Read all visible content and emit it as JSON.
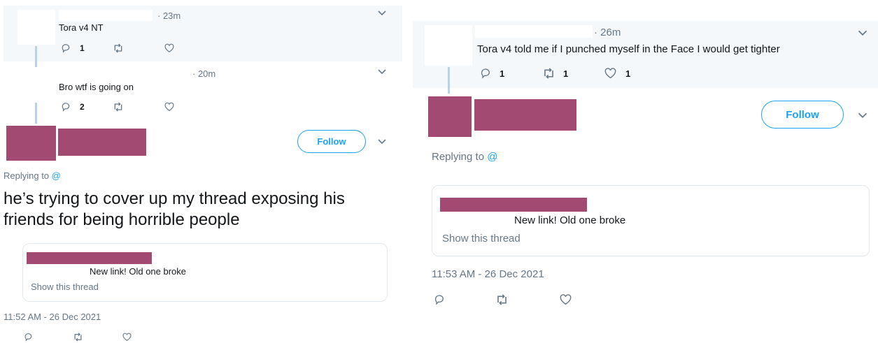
{
  "left": {
    "tweet1": {
      "time": "· 23m",
      "text": "Tora v4 NT",
      "replies": "1",
      "retweets": "",
      "likes": ""
    },
    "tweet2": {
      "time": "· 20m",
      "text": "Bro wtf is going on",
      "replies": "2",
      "retweets": "",
      "likes": ""
    },
    "main": {
      "follow_label": "Follow",
      "replying_label": "Replying to",
      "replying_handle": "@",
      "text": "he’s trying to cover up my thread exposing his friends for being horrible people",
      "quote_text": "New link! Old one broke",
      "show_thread": "Show this thread",
      "timestamp": "11:52 AM - 26 Dec 2021"
    }
  },
  "right": {
    "tweet1": {
      "time": "· 26m",
      "text": "Tora v4 told me if I punched myself in the Face I would get tighter",
      "replies": "1",
      "retweets": "1",
      "likes": "1"
    },
    "main": {
      "follow_label": "Follow",
      "replying_label": "Replying to",
      "replying_handle": "@",
      "quote_text": "New link! Old one broke",
      "show_thread": "Show this thread",
      "timestamp": "11:53 AM - 26 Dec 2021"
    }
  },
  "colors": {
    "accent": "#1da1f2",
    "redaction": "#a34a72",
    "muted": "#657786"
  },
  "icons": [
    "reply-icon",
    "retweet-icon",
    "like-icon",
    "chevron-down-icon"
  ]
}
